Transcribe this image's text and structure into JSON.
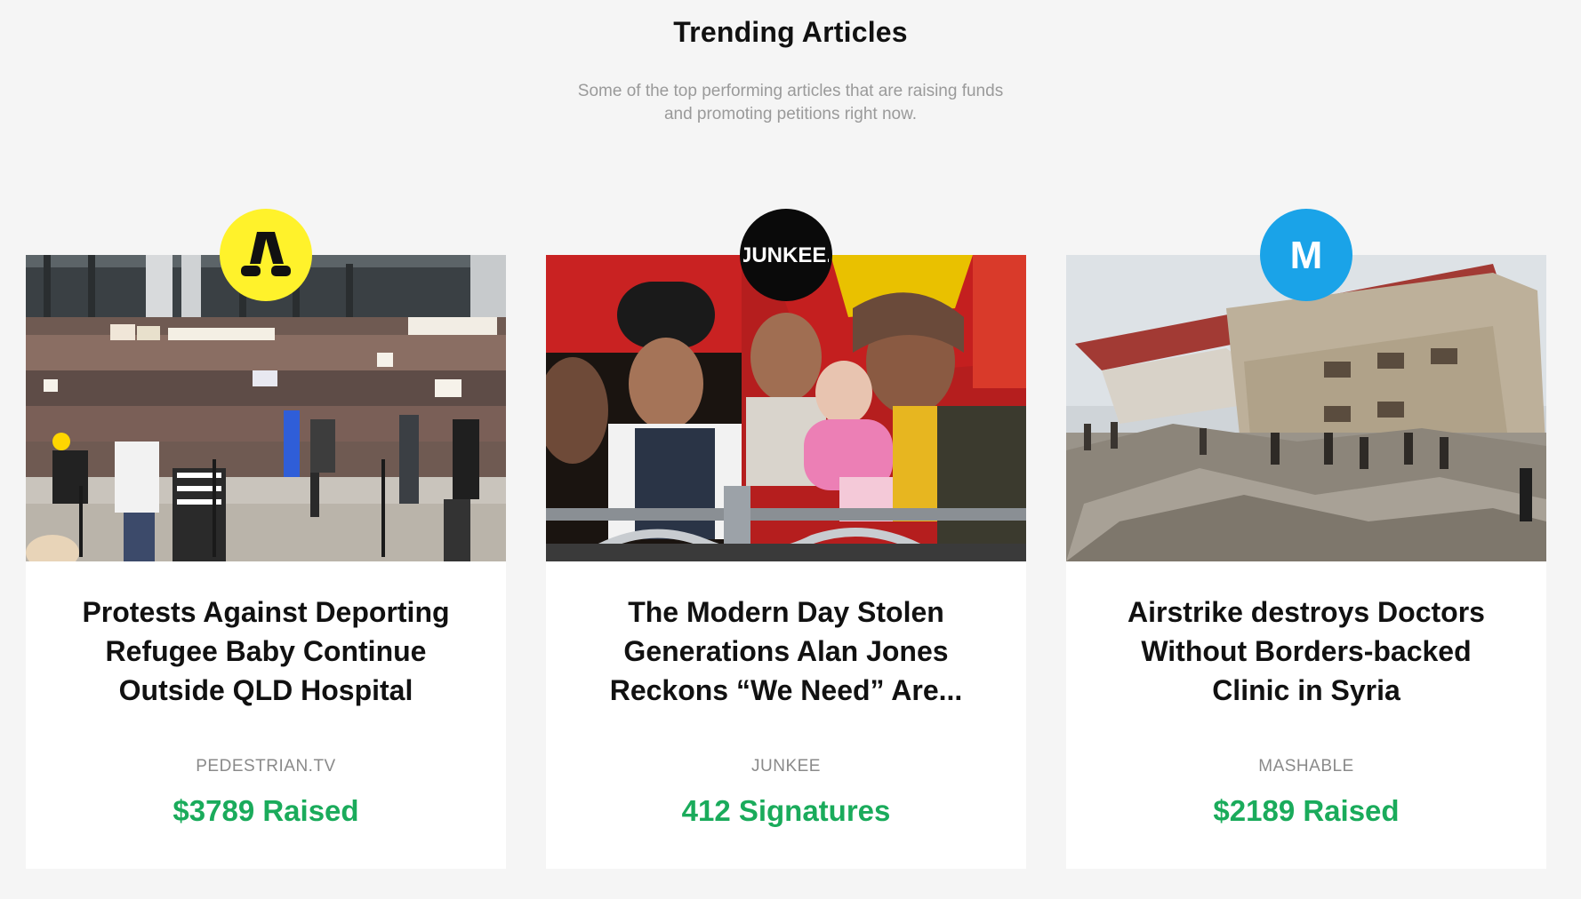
{
  "header": {
    "title": "Trending Articles",
    "subtitle": "Some of the top performing articles that are raising funds and promoting petitions right now."
  },
  "colors": {
    "stat_green": "#1aab5b",
    "pedestrian_yellow": "#fff22b",
    "junkee_black": "#0a0a0a",
    "mashable_blue": "#1aa3e8"
  },
  "articles": [
    {
      "title": "Protests Against Deporting Refugee Baby Continue Outside QLD Hospital",
      "source": "PEDESTRIAN.TV",
      "stat": "$3789 Raised",
      "logo_icon": "pedestrian-logo-icon",
      "image_icon": "protest-crowd-photo"
    },
    {
      "title": "The Modern Day Stolen Generations Alan Jones Reckons “We Need” Are...",
      "source": "JUNKEE",
      "stat": "412 Signatures",
      "logo_text": "JUNKEE.",
      "logo_icon": "junkee-logo-icon",
      "image_icon": "aboriginal-women-photo"
    },
    {
      "title": "Airstrike destroys Doctors Without Borders-backed Clinic in Syria",
      "source": "MASHABLE",
      "stat": "$2189 Raised",
      "logo_text": "M",
      "logo_icon": "mashable-logo-icon",
      "image_icon": "destroyed-clinic-photo"
    }
  ]
}
